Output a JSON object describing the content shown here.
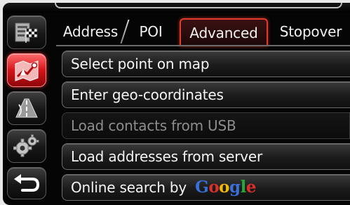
{
  "tabs": [
    {
      "label": "Address",
      "active": false
    },
    {
      "label": "POI",
      "active": false
    },
    {
      "label": "Advanced",
      "active": true
    },
    {
      "label": "Stopover",
      "active": false
    }
  ],
  "list": [
    {
      "label": "Select point on map",
      "enabled": true
    },
    {
      "label": "Enter geo-coordinates",
      "enabled": true
    },
    {
      "label": "Load contacts from USB",
      "enabled": false
    },
    {
      "label": "Load addresses from server",
      "enabled": true
    },
    {
      "label": "Online search by",
      "enabled": true
    }
  ],
  "google_logo": {
    "letters": [
      "G",
      "o",
      "o",
      "g",
      "l",
      "e"
    ],
    "colors": [
      "#3a6fd8",
      "#d9302c",
      "#f2b60a",
      "#3a6fd8",
      "#2aa73a",
      "#d9302c"
    ]
  },
  "rail": [
    {
      "icon": "destination-flag-icon",
      "active": false
    },
    {
      "icon": "navigation-map-icon",
      "active": true
    },
    {
      "icon": "route-road-icon",
      "active": false
    },
    {
      "icon": "settings-gears-icon",
      "active": false
    },
    {
      "icon": "back-arrow-icon",
      "active": false
    }
  ],
  "colors": {
    "accent_red": "#e43a2b",
    "background": "#050505",
    "text": "#f4f4f4",
    "disabled_text": "#8d8d8d"
  }
}
